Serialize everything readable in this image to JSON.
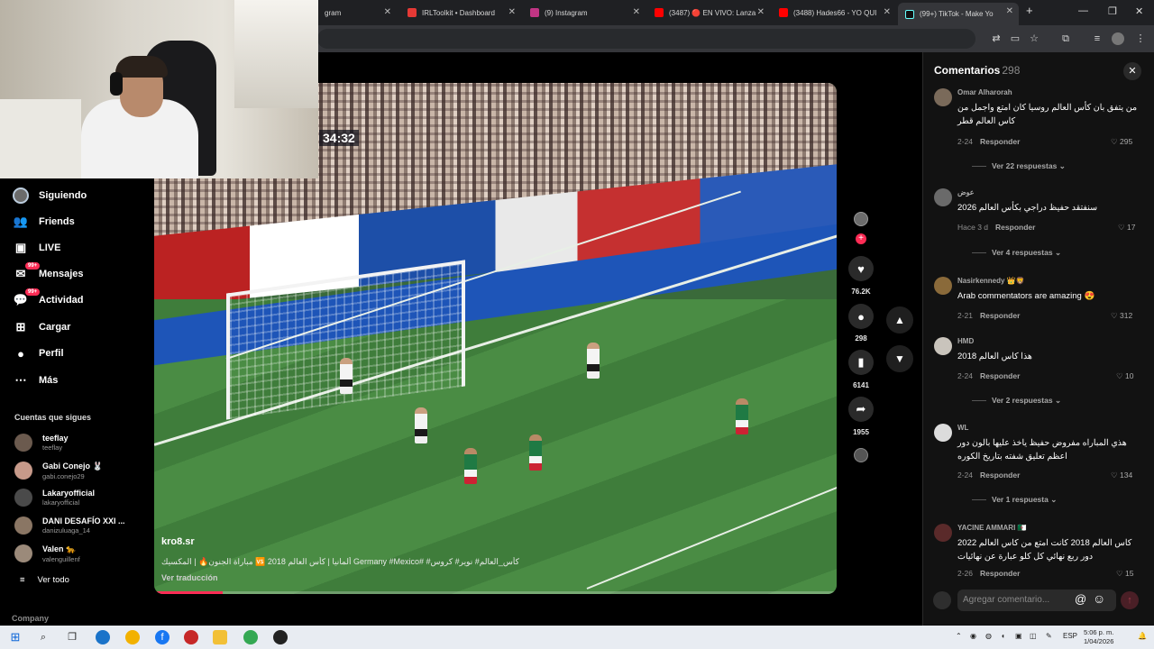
{
  "browser": {
    "tabs": [
      {
        "title": "gram",
        "icon_color": "#e1306c"
      },
      {
        "title": "IRLToolkit • Dashboard",
        "icon_color": "#e53935"
      },
      {
        "title": "(9) Instagram",
        "icon_color": "#c13584"
      },
      {
        "title": "(3487) 🔴 EN VIVO: Lanza",
        "icon_color": "#ff0000"
      },
      {
        "title": "(3488) Hades66 - YO QUI",
        "icon_color": "#ff0000"
      },
      {
        "title": "(99+) TikTok - Make Yo",
        "icon_color": "#111111"
      }
    ],
    "new_tab": "+",
    "controls": {
      "minimize": "—",
      "restore": "❐",
      "close": "✕"
    }
  },
  "nav": {
    "items": [
      {
        "label": "Siguiendo",
        "icon": "following-avatar-icon"
      },
      {
        "label": "Friends",
        "icon": "friends-icon"
      },
      {
        "label": "LIVE",
        "icon": "live-icon"
      },
      {
        "label": "Mensajes",
        "icon": "messages-icon",
        "badge": "99+"
      },
      {
        "label": "Actividad",
        "icon": "activity-icon",
        "badge": "99+"
      },
      {
        "label": "Cargar",
        "icon": "upload-icon"
      },
      {
        "label": "Perfil",
        "icon": "profile-icon"
      },
      {
        "label": "Más",
        "icon": "more-icon"
      }
    ],
    "following_title": "Cuentas que sigues",
    "following": [
      {
        "name": "teeflay",
        "handle": "teeflay",
        "color": "#6b5a4e"
      },
      {
        "name": "Gabi Conejo 🐰",
        "handle": "gabi.conejo29",
        "color": "#c79a8a"
      },
      {
        "name": "Lakaryofficial",
        "handle": "lakaryofficial",
        "color": "#4a4a4a"
      },
      {
        "name": "DANI DESAFÍO XXI ...",
        "handle": "danizuluaga_14",
        "color": "#8a7664"
      },
      {
        "name": "Valen 🐆",
        "handle": "valenguillenf",
        "color": "#9b8a7a"
      }
    ],
    "see_all": "Ver todo",
    "company": "Company"
  },
  "video": {
    "clock": "34:32",
    "author": "kro8.sr",
    "description": "كأس_العالم# نوير# كروس# #Germany #Mexico ألمانيا | كأس العالم 2018 🆚 مباراة الجنون🔥 | المكسيك",
    "translate": "Ver traducción",
    "progress": 0.1
  },
  "rail": {
    "likes": "76.2K",
    "comments": "298",
    "saves": "6141",
    "shares": "1955"
  },
  "comments_panel": {
    "title": "Comentarios",
    "count": "298",
    "comments": [
      {
        "user": "Omar Alharorah",
        "text": "من يتفق بان كأس العالم روسيا كان امتع واجمل من كاس العالم قطر",
        "date": "2-24",
        "likes": "295",
        "replies": "Ver 22 respuestas",
        "rtl": true,
        "color": "#7a6a5a"
      },
      {
        "user": "عوض",
        "text": "سنفتقد حفيظ دراجي بكأس العالم 2026",
        "date": "Hace 3 d",
        "likes": "17",
        "replies": "Ver 4 respuestas",
        "rtl": true,
        "color": "#6a6a6a"
      },
      {
        "user": "Nasirkennedy 👑🦁",
        "text": "Arab commentators are amazing 😍",
        "date": "2-21",
        "likes": "312",
        "replies": "",
        "rtl": false,
        "color": "#8a6a3a"
      },
      {
        "user": "HMD",
        "text": "هذا كاس العالم 2018",
        "date": "2-24",
        "likes": "10",
        "replies": "Ver 2 respuestas",
        "rtl": true,
        "color": "#c9c4bc"
      },
      {
        "user": "WL",
        "text": "هذي المباراه مفروض حفيظ ياخذ عليها بالون دور اعظم تعليق شفته بتاريخ الكوره",
        "date": "2-24",
        "likes": "134",
        "replies": "Ver 1 respuesta",
        "rtl": true,
        "color": "#dcdcdc"
      },
      {
        "user": "YACINE AMMARI 🇩🇿",
        "text": "كاس العالم 2018 كانت امتع من كاس العالم 2022 دور ربع نهائي كل كلو عبارة عن نهائيات",
        "date": "2-26",
        "likes": "15",
        "replies": "",
        "rtl": true,
        "color": "#5a2a2a"
      }
    ],
    "reply_label": "Responder",
    "input_placeholder": "Agregar comentario..."
  },
  "taskbar": {
    "language": "ESP",
    "time": "5:06 p. m.",
    "date": "1/04/2026"
  }
}
